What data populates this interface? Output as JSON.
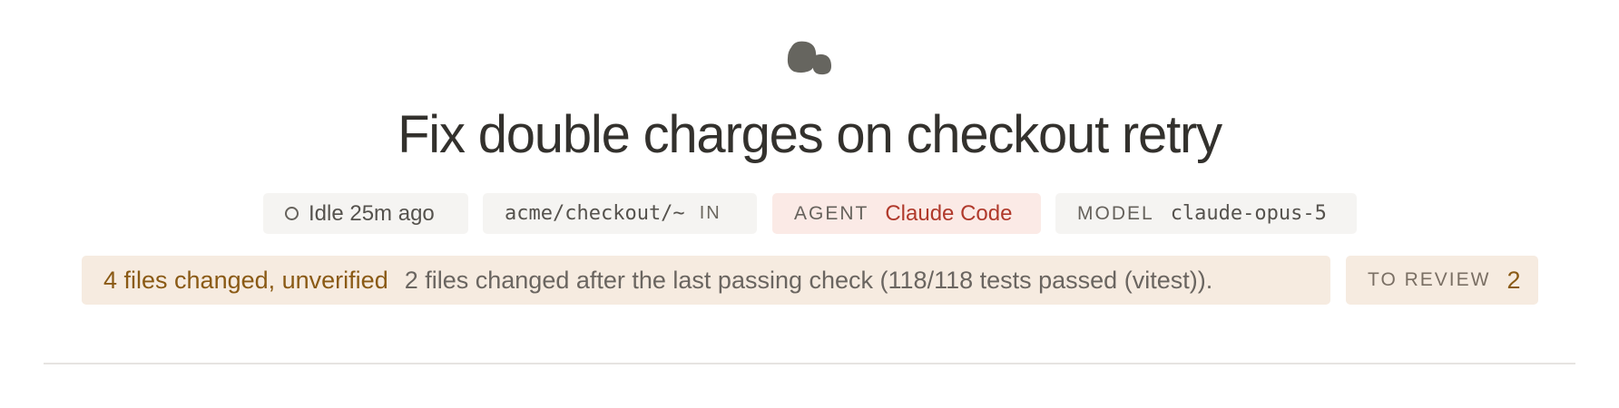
{
  "header": {
    "logo_icon": "stones-icon",
    "title": "Fix double charges on checkout retry"
  },
  "meta": {
    "status": {
      "icon": "circle-outline-icon",
      "label": "Idle 25m ago"
    },
    "path": {
      "value": "acme/checkout/~",
      "suffix": "IN"
    },
    "agent": {
      "key": "AGENT",
      "value": "Claude Code"
    },
    "model": {
      "key": "MODEL",
      "value": "claude-opus-5"
    }
  },
  "verification": {
    "headline": "4 files changed, unverified",
    "detail": "2 files changed after the last passing check (118/118 tests passed (vitest)).",
    "review_label": "TO REVIEW",
    "review_count": "2"
  },
  "colors": {
    "accent_warning": "#8a5a15",
    "agent_value": "#b0392b",
    "banner_bg": "#f6ebe0",
    "pill_bg": "#f5f4f2",
    "agent_pill_bg": "#fbeae6"
  }
}
